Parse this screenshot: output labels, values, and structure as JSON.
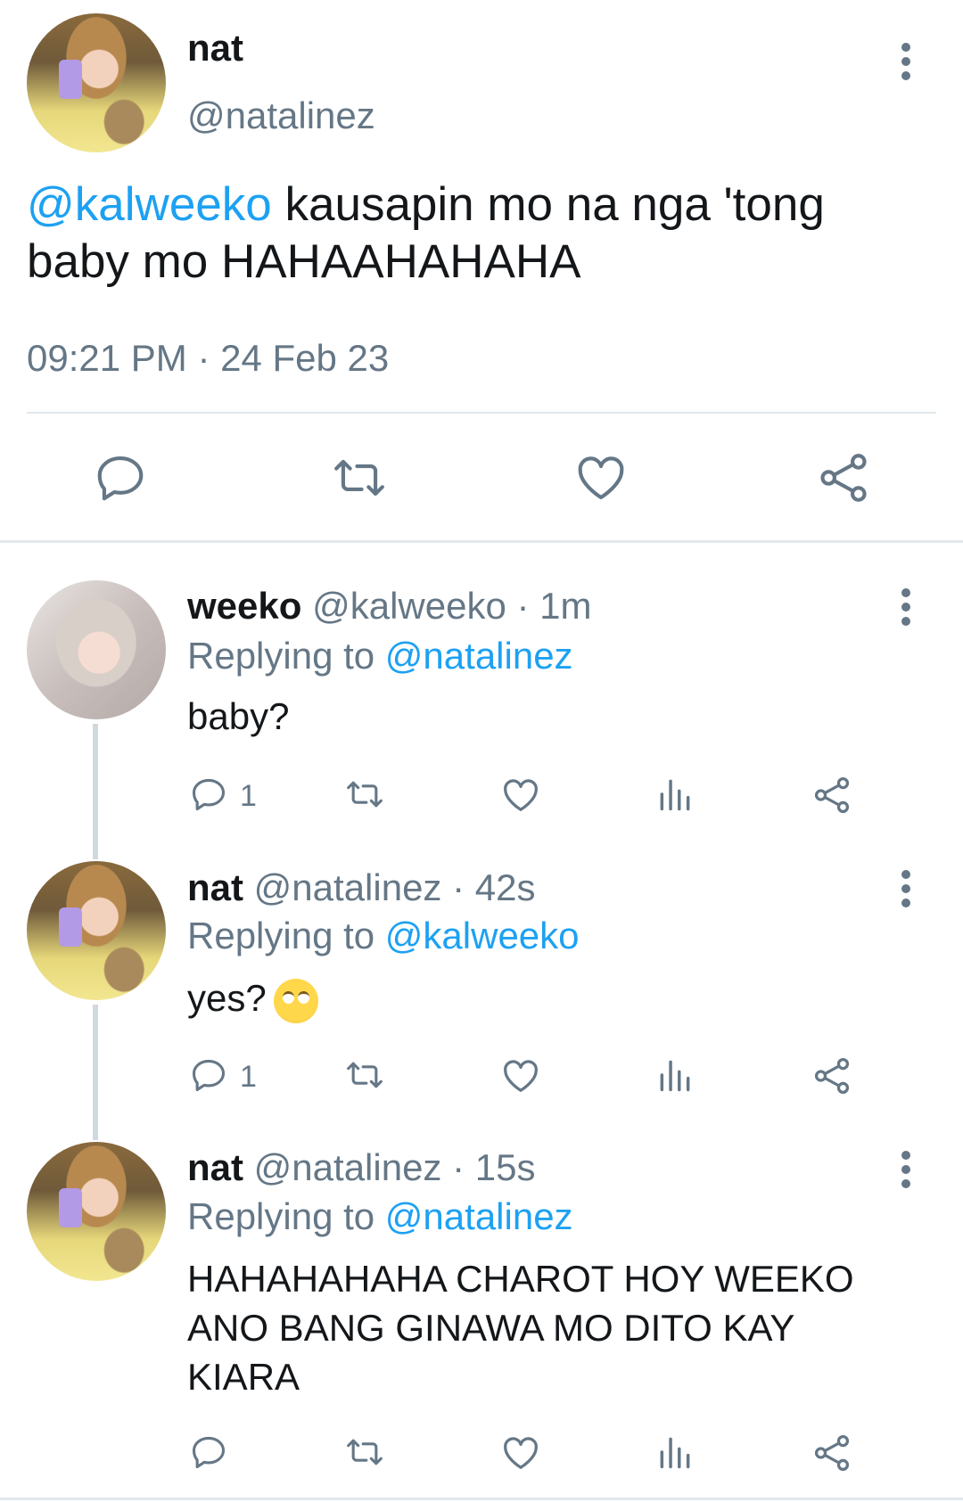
{
  "main_tweet": {
    "name": "nat",
    "handle": "@natalinez",
    "mention": "@kalweeko",
    "text_line1": " kausapin mo na nga 'tong",
    "text_line2": "baby mo HAHAAHAHAHA",
    "timestamp": "09:21 PM · 24 Feb 23"
  },
  "replies": [
    {
      "name": "weeko",
      "handle": "@kalweeko",
      "time": "· 1m",
      "replying_prefix": "Replying to ",
      "replying_to": "@natalinez",
      "text": "baby?",
      "reply_count": "1"
    },
    {
      "name": "nat",
      "handle": "@natalinez",
      "time": "· 42s",
      "replying_prefix": "Replying to ",
      "replying_to": "@kalweeko",
      "text": "yes?",
      "emoji": "face-with-rolling-eyes",
      "reply_count": "1"
    },
    {
      "name": "nat",
      "handle": "@natalinez",
      "time": "· 15s",
      "replying_prefix": "Replying to ",
      "replying_to": "@natalinez",
      "text_line1": "HAHAHAHAHA CHAROT HOY WEEKO",
      "text_line2": "ANO BANG GINAWA MO DITO KAY",
      "text_line3": "KIARA"
    }
  ],
  "colors": {
    "accent": "#1da1f2",
    "secondary_text": "#657786",
    "divider": "#e1e8ed"
  }
}
